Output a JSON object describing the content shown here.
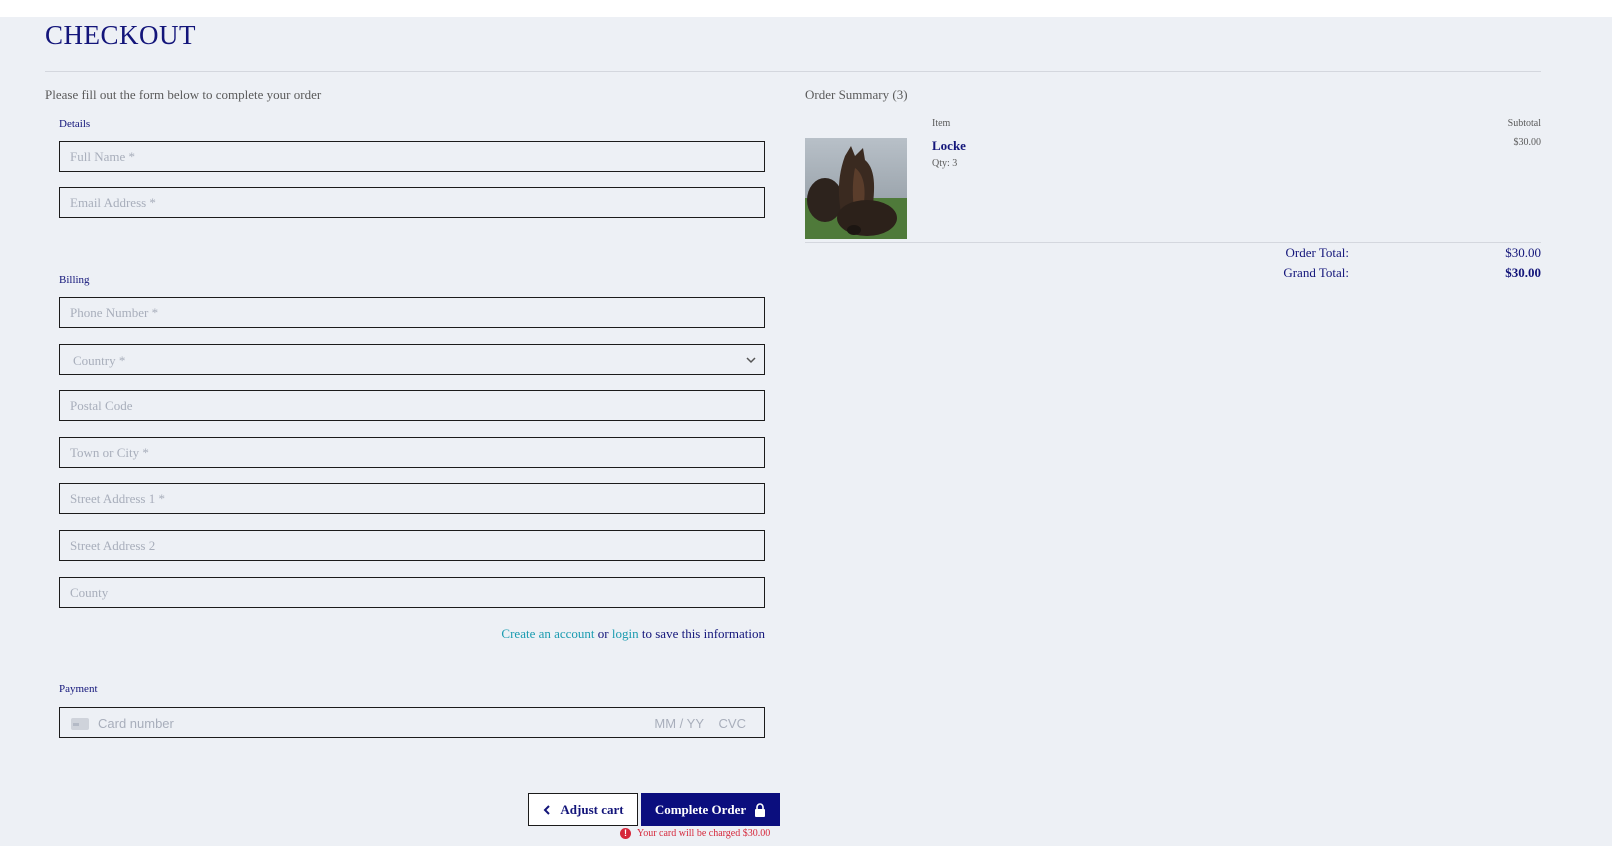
{
  "page": {
    "title": "CHECKOUT",
    "subtitle": "Please fill out the form below to complete your order"
  },
  "details": {
    "label": "Details",
    "full_name_placeholder": "Full Name *",
    "email_placeholder": "Email Address *"
  },
  "billing": {
    "label": "Billing",
    "phone_placeholder": "Phone Number *",
    "country_placeholder": "Country *",
    "postal_placeholder": "Postal Code",
    "town_placeholder": "Town or City *",
    "street1_placeholder": "Street Address 1 *",
    "street2_placeholder": "Street Address 2",
    "county_placeholder": "County"
  },
  "account": {
    "create_link": "Create an account",
    "or_text": "or",
    "login_link": "login",
    "suffix_text": "to save this information"
  },
  "payment": {
    "label": "Payment",
    "card_number_placeholder": "Card number",
    "expiry_placeholder": "MM / YY",
    "cvc_placeholder": "CVC"
  },
  "actions": {
    "adjust_label": "Adjust cart",
    "complete_label": "Complete Order",
    "charge_note": "Your card will be charged $30.00"
  },
  "summary": {
    "title": "Order Summary (3)",
    "col_item": "Item",
    "col_subtotal": "Subtotal",
    "items": [
      {
        "name": "Locke",
        "qty": "Qty: 3",
        "subtotal": "$30.00"
      }
    ],
    "order_total_label": "Order Total:",
    "order_total_value": "$30.00",
    "grand_total_label": "Grand Total:",
    "grand_total_value": "$30.00"
  },
  "colors": {
    "brand_navy": "#0b0e7e",
    "link_teal": "#1a9bb0",
    "error_red": "#d6283b",
    "background": "#edf0f5"
  }
}
